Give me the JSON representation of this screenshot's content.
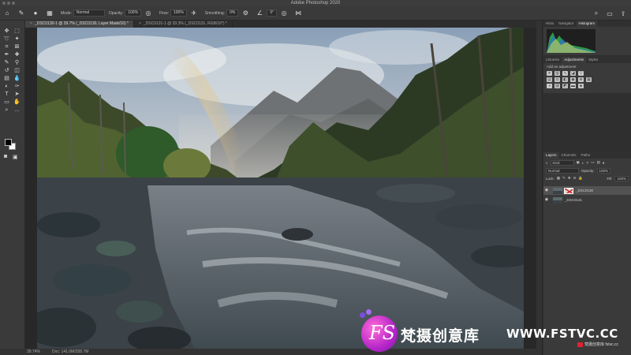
{
  "window": {
    "title": "Adobe Photoshop 2020"
  },
  "options_bar": {
    "mode_label": "Mode:",
    "mode_value": "Normal",
    "opacity_label": "Opacity:",
    "opacity_value": "100%",
    "flow_label": "Flow:",
    "flow_value": "100%",
    "smoothing_label": "Smoothing:",
    "smoothing_value": "0%",
    "angle_value": "0°"
  },
  "tabs": [
    {
      "label": "_DSC0130-1 @ 39.7% (_DSC0130, Layer Mask/16) *"
    },
    {
      "label": "_DSC0131-1 @ 33.3% (_DSC0131, RGB/16*) *"
    }
  ],
  "panels": {
    "histogram_tabs": [
      "Histo",
      "Navigator",
      "Histogram"
    ],
    "adjust_tabs": [
      "Libraries",
      "Adjustments",
      "Styles"
    ],
    "add_adjustment_label": "Add an adjustment",
    "layers_tabs": [
      "Layers",
      "Channels",
      "Paths"
    ],
    "filter_kind": "Kind",
    "blend_mode": "Normal",
    "opacity_label": "Opacity:",
    "opacity_value": "100%",
    "lock_label": "Lock:",
    "fill_label": "Fill:",
    "fill_value": "100%",
    "layers": [
      {
        "name": "_DSC0130",
        "selected": true,
        "has_mask": true
      },
      {
        "name": "_DSC0131",
        "selected": false,
        "has_mask": false
      }
    ]
  },
  "status": {
    "zoom": "39.74%",
    "doc": "Doc: 141.0M/258.7M"
  },
  "watermark": {
    "logo_text": "FS",
    "cn_text": "梵摄创意库",
    "url": "WWW.FSTVC.CC",
    "badge": "梵摄创意库 fstvc.cc"
  },
  "colors": {
    "accent": "#b626c9",
    "ui_dark": "#3a3a3a",
    "ui_darker": "#282828"
  }
}
